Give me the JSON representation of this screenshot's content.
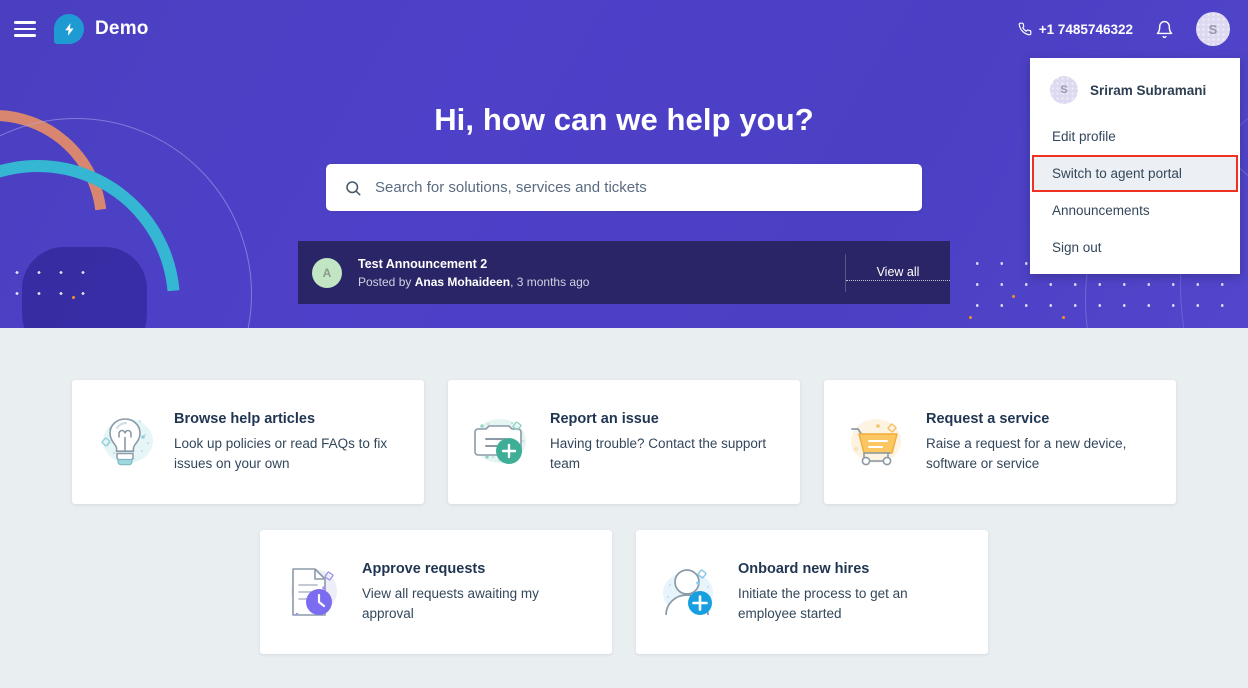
{
  "header": {
    "menu_icon": "hamburger-icon",
    "brand_name": "Demo",
    "logo_icon": "lightning-bolt-logo",
    "phone": "+1 7485746322",
    "phone_icon": "phone-icon",
    "notification_icon": "bell-icon",
    "avatar_initial": "S"
  },
  "profile_menu": {
    "user_name": "Sriram Subramani",
    "user_initial": "S",
    "items": [
      {
        "label": "Edit profile",
        "highlighted": false
      },
      {
        "label": "Switch to agent portal",
        "highlighted": true
      },
      {
        "label": "Announcements",
        "highlighted": false
      },
      {
        "label": "Sign out",
        "highlighted": false
      }
    ],
    "highlight_color": "#ef3124"
  },
  "hero": {
    "title": "Hi, how can we help you?",
    "search_placeholder": "Search for solutions, services and tickets",
    "search_value": "",
    "search_icon": "search-icon",
    "background_color": "#4e41c9"
  },
  "announcement": {
    "avatar_initial": "A",
    "title": "Test Announcement 2",
    "posted_by_prefix": "Posted by ",
    "author": "Anas Mohaideen",
    "time_suffix": ", 3 months ago",
    "view_all_label": "View all"
  },
  "cards": {
    "row1": [
      {
        "icon": "lightbulb-icon",
        "title": "Browse help articles",
        "description": "Look up policies or read FAQs to fix issues on your own"
      },
      {
        "icon": "report-issue-icon",
        "title": "Report an issue",
        "description": "Having trouble? Contact the support team"
      },
      {
        "icon": "shopping-cart-icon",
        "title": "Request a service",
        "description": "Raise a request for a new device, software or service"
      }
    ],
    "row2": [
      {
        "icon": "approve-document-clock-icon",
        "title": "Approve requests",
        "description": "View all requests awaiting my approval"
      },
      {
        "icon": "person-add-icon",
        "title": "Onboard new hires",
        "description": "Initiate the process to get an employee started"
      }
    ]
  }
}
